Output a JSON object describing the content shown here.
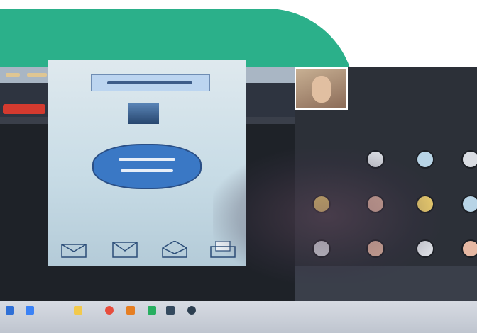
{
  "scene": {
    "description_visible_text": "",
    "accent_green": "#2bb08a",
    "recording_red": "#d43a2f"
  },
  "browser": {
    "bookmarks": [
      "",
      "",
      "",
      "",
      "",
      "",
      ""
    ]
  },
  "meet": {
    "recording_pill_label": "",
    "meeting_title": "",
    "user_name": ""
  },
  "slide": {
    "title_text": "",
    "cloud_text": "",
    "envelope_icons": [
      "envelope-icon",
      "envelope-icon",
      "open-envelope-icon",
      "document-envelope-icon"
    ]
  },
  "participants": {
    "count_visible": 12
  },
  "taskbar": {
    "icons": [
      "start-icon",
      "search-icon",
      "folder-icon",
      "browser-icon",
      "app-icon",
      "app-icon",
      "app-icon",
      "app-icon"
    ]
  }
}
